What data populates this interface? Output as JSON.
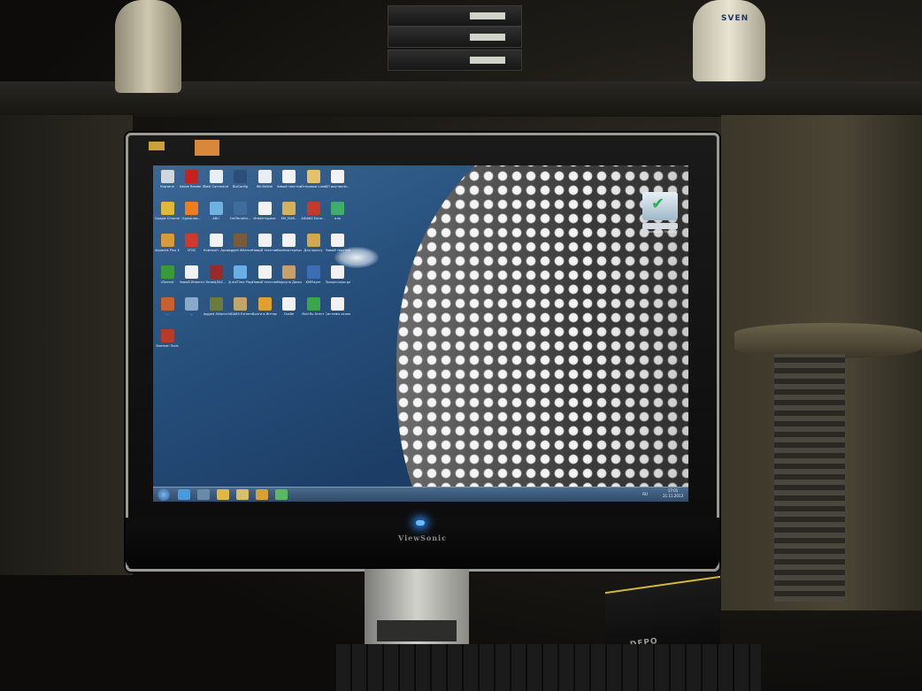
{
  "photo": {
    "speaker_brand": "SVEN",
    "monitor_brand": "ViewSonic",
    "pc_brand": "DEPO"
  },
  "desktop": {
    "icons": [
      {
        "label": "Корзина",
        "color": "#cfd6de"
      },
      {
        "label": "Adobe Reader X",
        "color": "#c4221b"
      },
      {
        "label": "Total Commander",
        "color": "#e9eef3"
      },
      {
        "label": "BioConfig",
        "color": "#2b4f7a"
      },
      {
        "label": "WinToDisk",
        "color": "#e9eef3"
      },
      {
        "label": "Новый текстовый...",
        "color": "#f2f2f2"
      },
      {
        "label": "Отправка слова",
        "color": "#e4c16a"
      },
      {
        "label": "БП выставле...",
        "color": "#f2f2f2"
      },
      {
        "label": "Google Chrome",
        "color": "#e0b83a"
      },
      {
        "label": "Одноклас...",
        "color": "#ef7d1e"
      },
      {
        "label": "ABU",
        "color": "#6fb1e0"
      },
      {
        "label": "CellTerrafor...",
        "color": "#3e6d9c"
      },
      {
        "label": "Инвентаризи",
        "color": "#f2f2f2"
      },
      {
        "label": "EM_FAMI..",
        "color": "#d3b35a"
      },
      {
        "label": "AIDA64 Extre...",
        "color": "#c33a2a"
      },
      {
        "label": "ало",
        "color": "#3fae6d"
      },
      {
        "label": "Aquarels Plus 10",
        "color": "#d89a3a"
      },
      {
        "label": "2ГИС",
        "color": "#cf3a2a"
      },
      {
        "label": "Компьют. Арсде...",
        "color": "#f2f2f2"
      },
      {
        "label": "Jagged Alliance Ba...",
        "color": "#7b5a3a"
      },
      {
        "label": "Новый текстовый...",
        "color": "#f2f2f2"
      },
      {
        "label": "Компьютерныс",
        "color": "#f2f2f2"
      },
      {
        "label": "Для кроссу",
        "color": "#d2a94a"
      },
      {
        "label": "Новый текстовый...",
        "color": "#f2f2f2"
      },
      {
        "label": "uTorrent",
        "color": "#3a9a3a"
      },
      {
        "label": "Новый Инвентарь",
        "color": "#f2f2f2"
      },
      {
        "label": "КлавЦЛАС...",
        "color": "#9a2a2a"
      },
      {
        "label": "QuickTime Player",
        "color": "#6aaee6"
      },
      {
        "label": "Новый текстов...",
        "color": "#f2f2f2"
      },
      {
        "label": "Моркуна Диоис...",
        "color": "#c9a06a"
      },
      {
        "label": "KMPlayer",
        "color": "#3a6fb4"
      },
      {
        "label": "Процессоры десктоп Ии...",
        "color": "#f2f2f2"
      },
      {
        "label": "...",
        "color": "#c9612e"
      },
      {
        "label": "...",
        "color": "#8aa8c8"
      },
      {
        "label": "Jagged Alliance Ba...",
        "color": "#6e7a3a"
      },
      {
        "label": "AIDA64 Extrem...",
        "color": "#c4a46a"
      },
      {
        "label": "Волги в Интернет",
        "color": "#e0a02e"
      },
      {
        "label": "Скайп",
        "color": "#f2f2f2"
      },
      {
        "label": "Mail.Ru Агент",
        "color": "#3aa64a"
      },
      {
        "label": "Системы охлаждени...",
        "color": "#f2f2f2"
      },
      {
        "label": "Daemon Tools",
        "color": "#b83a2a"
      }
    ],
    "gadget_caption": "Проверен Hyper-V",
    "taskbar": {
      "apps": [
        {
          "name": "ie",
          "color": "#4a9ade"
        },
        {
          "name": "media",
          "color": "#6a8aaa"
        },
        {
          "name": "explorer",
          "color": "#e0b84a"
        },
        {
          "name": "folder",
          "color": "#d9bd6a"
        },
        {
          "name": "chrome",
          "color": "#d7a13a"
        },
        {
          "name": "skype",
          "color": "#5ab860"
        }
      ],
      "lang": "RU",
      "time": "17:01",
      "date": "21.11.2013"
    }
  }
}
